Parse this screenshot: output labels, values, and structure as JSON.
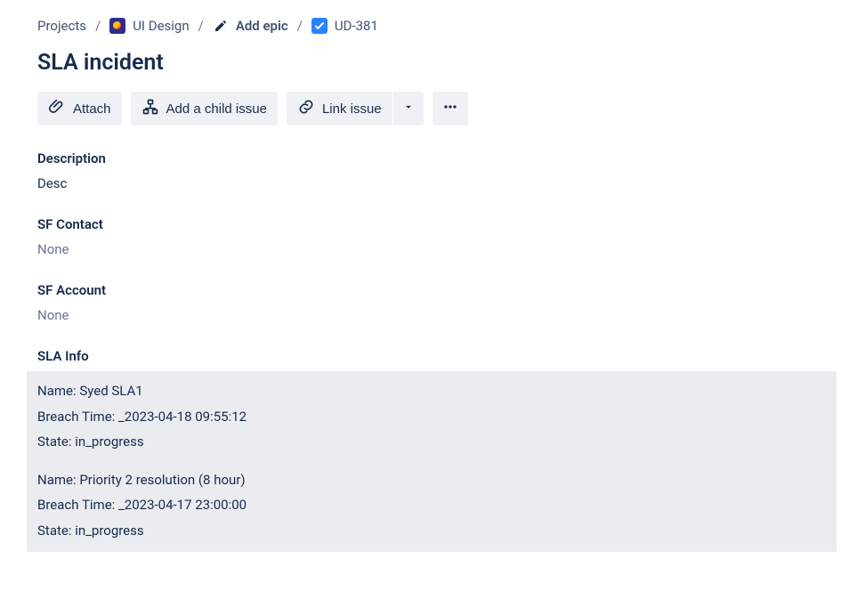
{
  "breadcrumb": {
    "projects": "Projects",
    "project_name": "UI Design",
    "add_epic": "Add epic",
    "issue_key": "UD-381"
  },
  "title": "SLA incident",
  "actions": {
    "attach": "Attach",
    "add_child": "Add a child issue",
    "link_issue": "Link issue"
  },
  "description": {
    "label": "Description",
    "value": "Desc"
  },
  "sf_contact": {
    "label": "SF Contact",
    "value": "None"
  },
  "sf_account": {
    "label": "SF Account",
    "value": "None"
  },
  "sla": {
    "label": "SLA Info",
    "items": [
      {
        "name_label": "Name:",
        "name": "Syed SLA1",
        "breach_label": "Breach Time:",
        "breach": "_2023-04-18 09:55:12",
        "state_label": "State:",
        "state": "in_progress"
      },
      {
        "name_label": "Name:",
        "name": "Priority 2 resolution (8 hour)",
        "breach_label": "Breach Time:",
        "breach": "_2023-04-17 23:00:00",
        "state_label": "State:",
        "state": "in_progress"
      }
    ]
  }
}
